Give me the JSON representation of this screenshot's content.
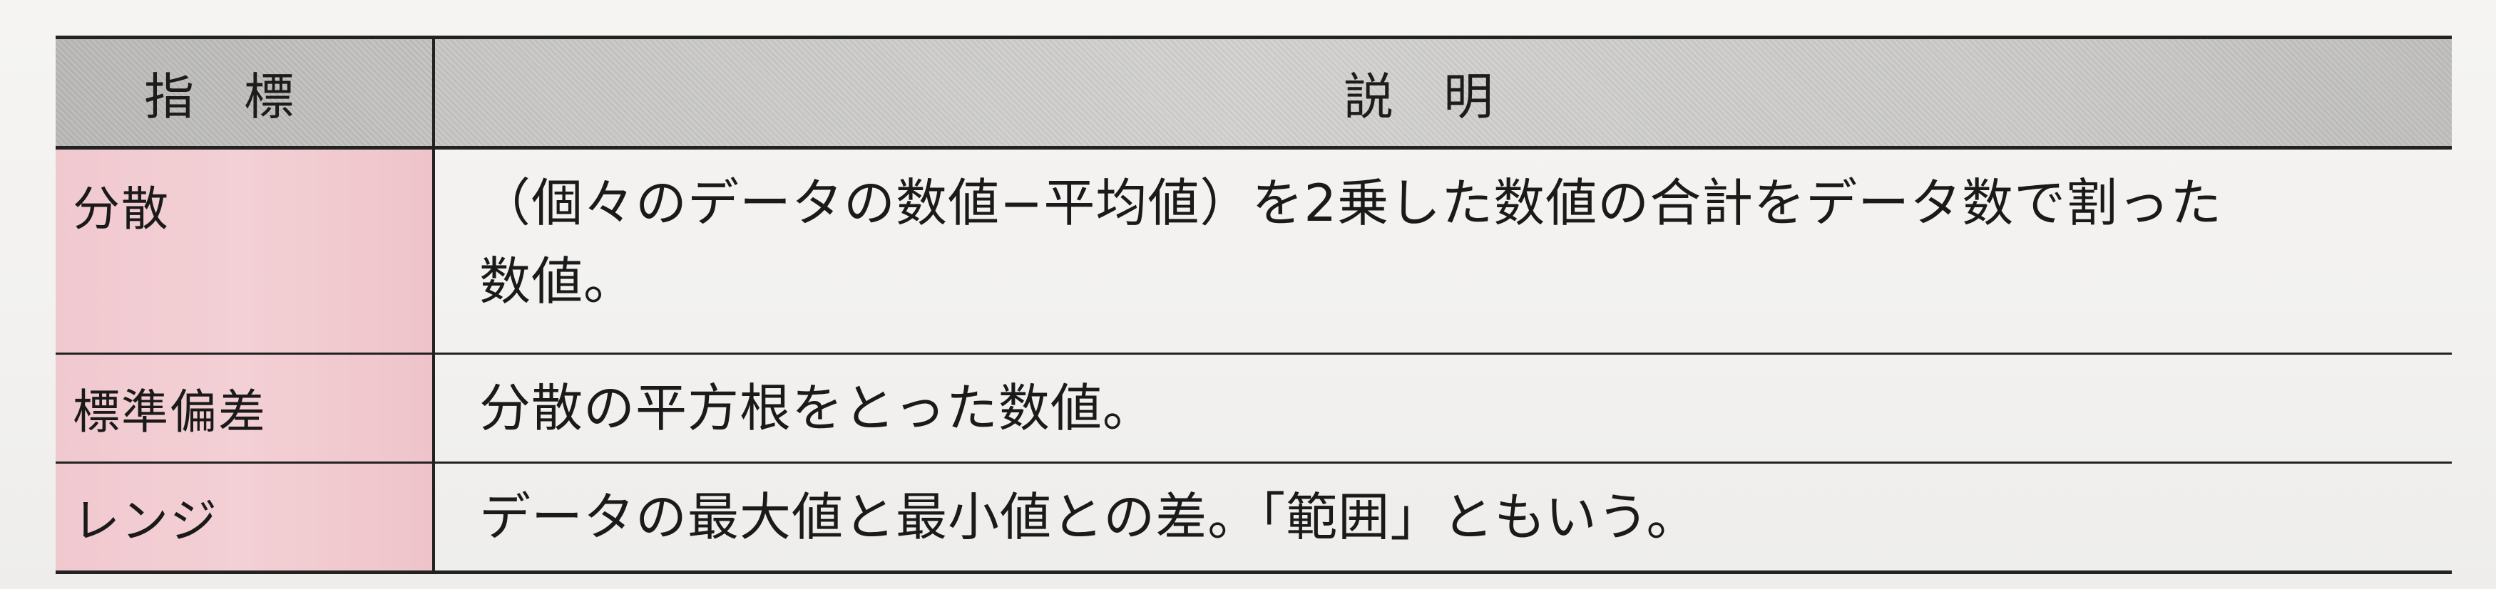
{
  "table": {
    "headers": {
      "indicator": "指標",
      "description": "説明"
    },
    "rows": [
      {
        "term": "分散",
        "description_line1": "（個々のデータの数値−平均値）を2乗した数値の合計をデータ数で割った",
        "description_line2": "数値。"
      },
      {
        "term": "標準偏差",
        "description_line1": "分散の平方根をとった数値。"
      },
      {
        "term": "レンジ",
        "description_line1": "データの最大値と最小値との差。「範囲」ともいう。"
      }
    ]
  },
  "colors": {
    "header_bg": "#cfcecc",
    "term_bg": "#f2cdd2",
    "rule": "#222222",
    "text": "#1a1a1a"
  }
}
